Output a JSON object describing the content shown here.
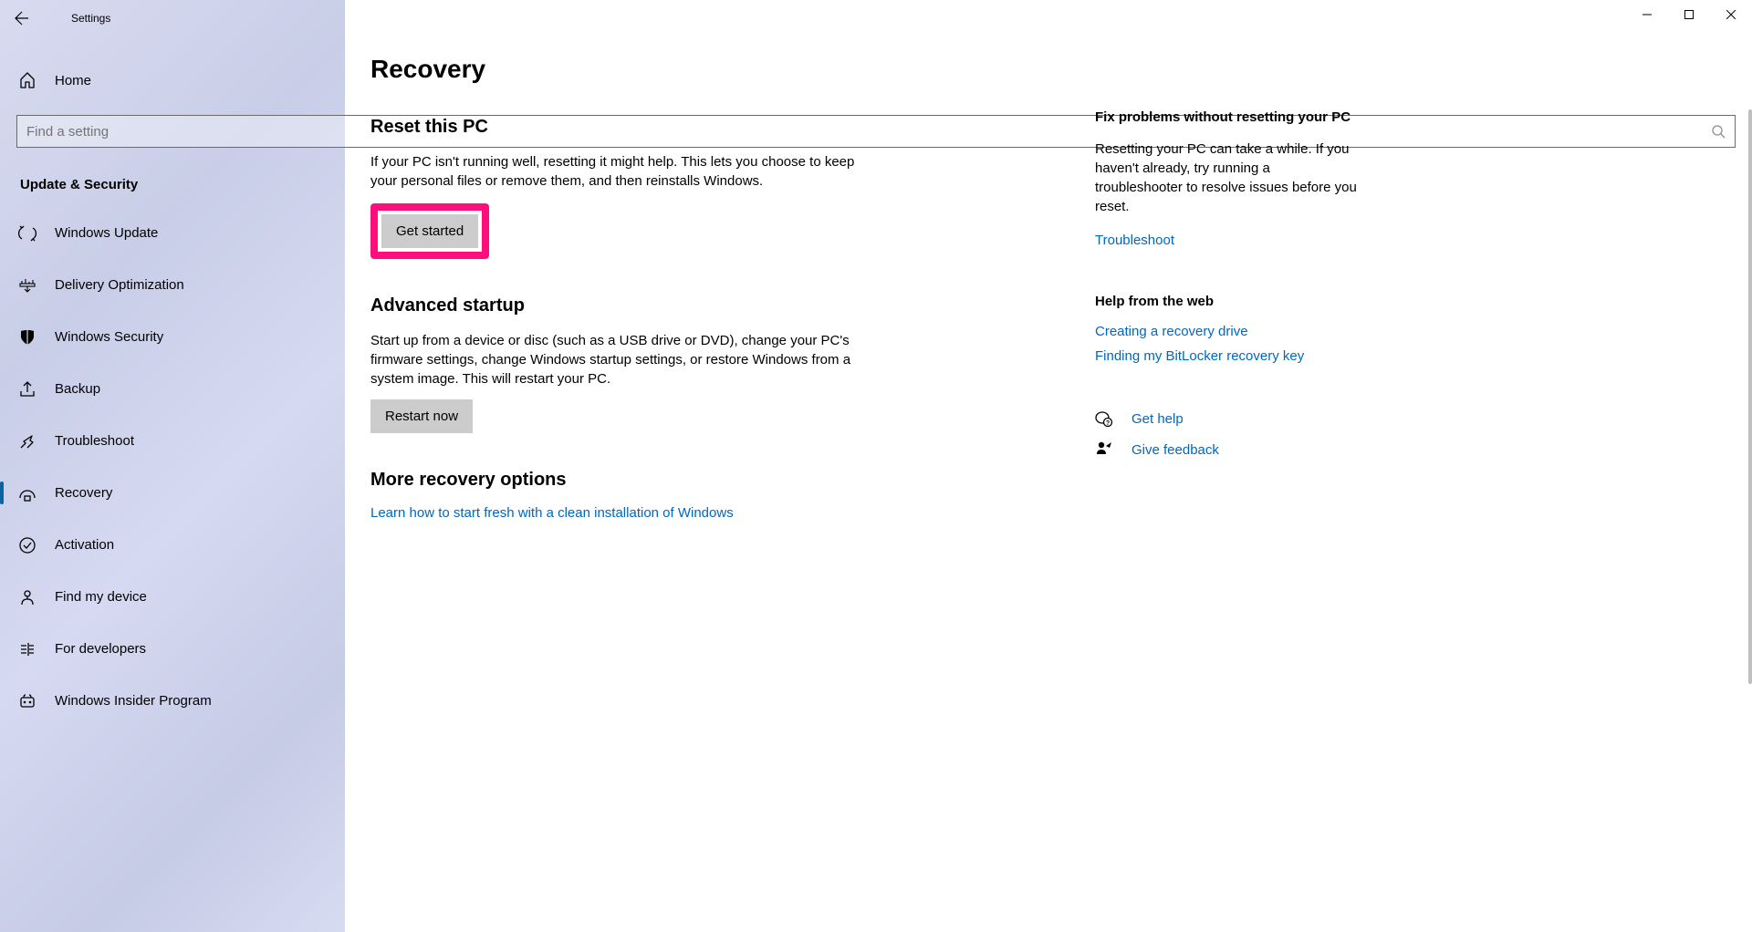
{
  "titlebar": {
    "app_name": "Settings"
  },
  "sidebar": {
    "home": "Home",
    "search_placeholder": "Find a setting",
    "section": "Update & Security",
    "items": [
      {
        "label": "Windows Update",
        "active": false
      },
      {
        "label": "Delivery Optimization",
        "active": false
      },
      {
        "label": "Windows Security",
        "active": false
      },
      {
        "label": "Backup",
        "active": false
      },
      {
        "label": "Troubleshoot",
        "active": false
      },
      {
        "label": "Recovery",
        "active": true
      },
      {
        "label": "Activation",
        "active": false
      },
      {
        "label": "Find my device",
        "active": false
      },
      {
        "label": "For developers",
        "active": false
      },
      {
        "label": "Windows Insider Program",
        "active": false
      }
    ]
  },
  "main": {
    "title": "Recovery",
    "reset": {
      "heading": "Reset this PC",
      "body": "If your PC isn't running well, resetting it might help. This lets you choose to keep your personal files or remove them, and then reinstalls Windows.",
      "button": "Get started"
    },
    "advanced": {
      "heading": "Advanced startup",
      "body": "Start up from a device or disc (such as a USB drive or DVD), change your PC's firmware settings, change Windows startup settings, or restore Windows from a system image. This will restart your PC.",
      "button": "Restart now"
    },
    "more": {
      "heading": "More recovery options",
      "link": "Learn how to start fresh with a clean installation of Windows"
    }
  },
  "right": {
    "fix": {
      "heading": "Fix problems without resetting your PC",
      "body": "Resetting your PC can take a while. If you haven't already, try running a troubleshooter to resolve issues before you reset.",
      "link": "Troubleshoot"
    },
    "web": {
      "heading": "Help from the web",
      "links": [
        "Creating a recovery drive",
        "Finding my BitLocker recovery key"
      ]
    },
    "help": "Get help",
    "feedback": "Give feedback"
  }
}
